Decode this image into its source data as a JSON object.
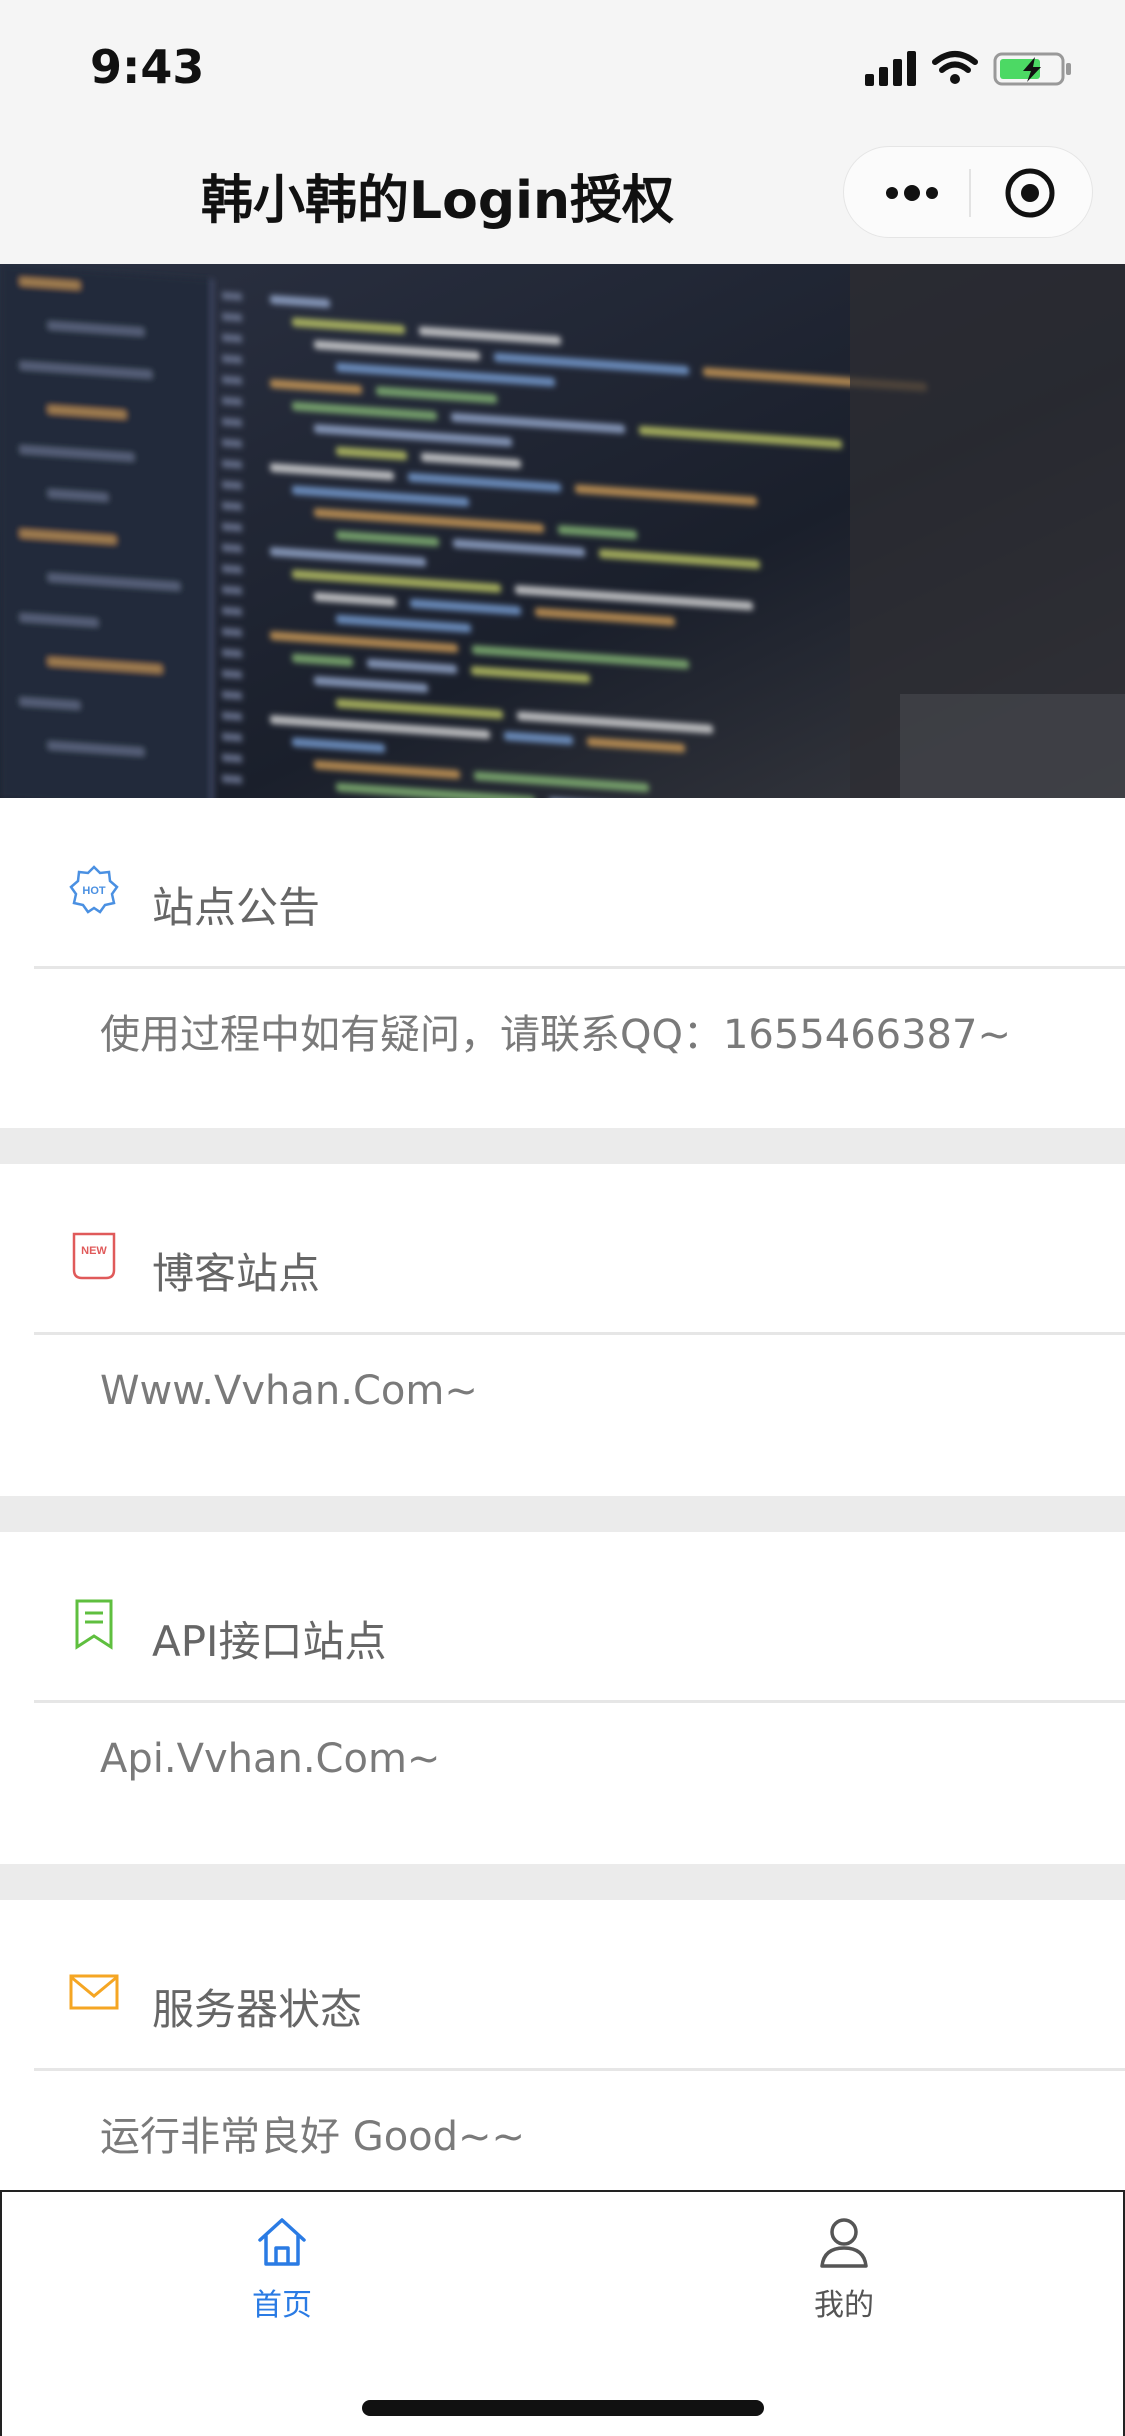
{
  "status_bar": {
    "time": "9:43"
  },
  "nav": {
    "title": "韩小韩的Login授权"
  },
  "cards": [
    {
      "title": "站点公告",
      "body": "使用过程中如有疑问，请联系QQ：1655466387~",
      "icon": "hot-badge-icon",
      "color": "#4a90e2"
    },
    {
      "title": "博客站点",
      "body": "Www.Vvhan.Com~",
      "icon": "new-tag-icon",
      "color": "#e05a5a"
    },
    {
      "title": "API接口站点",
      "body": "Api.Vvhan.Com~",
      "icon": "bookmark-icon",
      "color": "#5fbf3f"
    },
    {
      "title": "服务器状态",
      "body": "运行非常良好 Good~~",
      "icon": "mail-icon",
      "color": "#f5a623"
    }
  ],
  "icon_text": {
    "hot": "HOT",
    "new": "NEW"
  },
  "tabbar": {
    "items": [
      {
        "label": "首页",
        "icon": "home-icon",
        "active": true
      },
      {
        "label": "我的",
        "icon": "user-icon",
        "active": false
      }
    ],
    "active_color": "#2a7be4",
    "inactive_color": "#555555"
  },
  "colors": {
    "page_bg": "#ffffff",
    "separator": "#ebebeb",
    "text_muted": "#7a7a7a"
  }
}
